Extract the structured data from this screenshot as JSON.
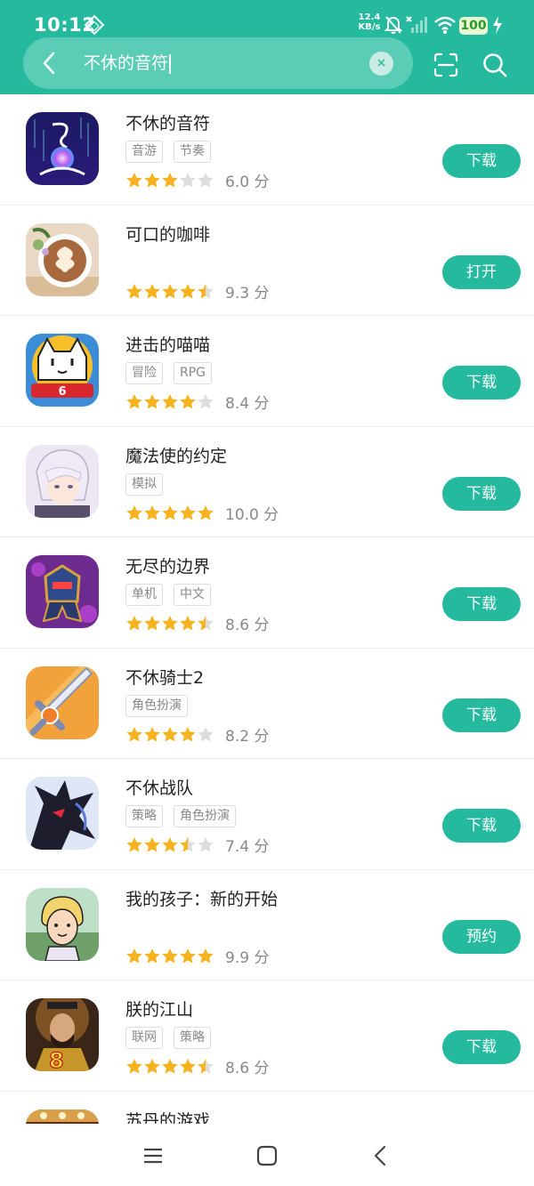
{
  "status_bar": {
    "time": "10:12",
    "net_speed_value": "12.4",
    "net_speed_unit": "KB/s",
    "battery": "100"
  },
  "search": {
    "query": "不休的音符",
    "clear_label": "×"
  },
  "colors": {
    "accent": "#25b99e",
    "star_filled": "#f6b21f",
    "star_empty": "#dddddd"
  },
  "apps": [
    {
      "name": "不休的音符",
      "tags": [
        "音游",
        "节奏"
      ],
      "rating": 3,
      "score": "6.0 分",
      "action": "下载",
      "icon": "music-note-orb-icon"
    },
    {
      "name": "可口的咖啡",
      "tags": [],
      "rating": 4.5,
      "score": "9.3 分",
      "action": "打开",
      "icon": "latte-art-icon"
    },
    {
      "name": "进击的喵喵",
      "tags": [
        "冒险",
        "RPG"
      ],
      "rating": 4,
      "score": "8.4 分",
      "action": "下载",
      "icon": "white-cat-icon"
    },
    {
      "name": "魔法使的约定",
      "tags": [
        "模拟"
      ],
      "rating": 5,
      "score": "10.0 分",
      "action": "下载",
      "icon": "anime-character-icon"
    },
    {
      "name": "无尽的边界",
      "tags": [
        "单机",
        "中文"
      ],
      "rating": 4.5,
      "score": "8.6 分",
      "action": "下载",
      "icon": "robot-knight-icon"
    },
    {
      "name": "不休骑士2",
      "tags": [
        "角色扮演"
      ],
      "rating": 4,
      "score": "8.2 分",
      "action": "下载",
      "icon": "sword-icon"
    },
    {
      "name": "不休战队",
      "tags": [
        "策略",
        "角色扮演"
      ],
      "rating": 3.5,
      "score": "7.4 分",
      "action": "下载",
      "icon": "dark-dragon-icon"
    },
    {
      "name": "我的孩子：新的开始",
      "tags": [],
      "rating": 5,
      "score": "9.9 分",
      "action": "预约",
      "icon": "child-portrait-icon"
    },
    {
      "name": "朕的江山",
      "tags": [
        "联网",
        "策略"
      ],
      "rating": 4.5,
      "score": "8.6 分",
      "action": "下载",
      "icon": "emperor-icon"
    },
    {
      "name": "苏丹的游戏",
      "tags": [],
      "rating": 0,
      "score": "",
      "action": "",
      "icon": "sultan-icon"
    }
  ]
}
